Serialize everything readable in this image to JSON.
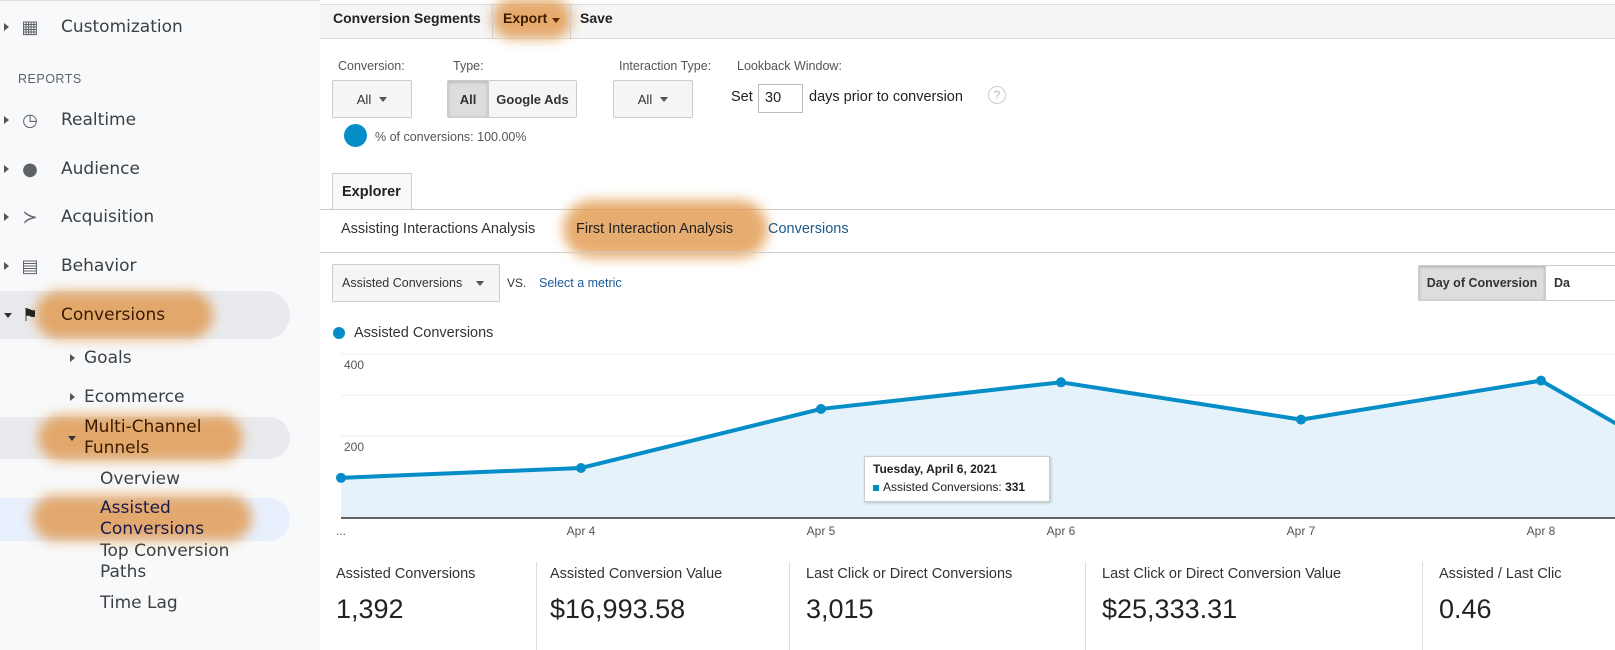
{
  "sidebar": {
    "customization": "Customization",
    "reports_heading": "REPORTS",
    "items": [
      {
        "label": "Realtime",
        "icon": "clock-icon"
      },
      {
        "label": "Audience",
        "icon": "person-icon"
      },
      {
        "label": "Acquisition",
        "icon": "acquisition-icon"
      },
      {
        "label": "Behavior",
        "icon": "behavior-icon"
      },
      {
        "label": "Conversions",
        "icon": "flag-icon"
      }
    ],
    "conversions_children": [
      "Goals",
      "Ecommerce",
      "Multi-Channel Funnels"
    ],
    "mcf_children": [
      "Overview",
      "Assisted Conversions",
      "Top Conversion Paths",
      "Time Lag"
    ]
  },
  "toolbar": {
    "segments": "Conversion Segments",
    "export": "Export",
    "save": "Save"
  },
  "filters": {
    "conversion_label": "Conversion:",
    "conversion_value": "All",
    "type_label": "Type:",
    "type_options": [
      "All",
      "Google Ads"
    ],
    "interaction_label": "Interaction Type:",
    "interaction_value": "All",
    "lookback_label": "Lookback Window:",
    "set": "Set",
    "lookback_days": "30",
    "lookback_suffix": "days prior to conversion",
    "help": "?",
    "pct_text": "% of conversions: 100.00%"
  },
  "tabs": {
    "explorer": "Explorer",
    "sub": [
      "Assisting Interactions Analysis",
      "First Interaction Analysis",
      "Conversions"
    ]
  },
  "metric": {
    "selected": "Assisted Conversions",
    "vs": "VS.",
    "select": "Select a metric",
    "day_of_conversion": "Day of Conversion",
    "day_other": "Da"
  },
  "colors": {
    "series": "#058dc7",
    "fill": "#e5f2f9",
    "highlight": "#e0913f"
  },
  "chart_data": {
    "type": "area",
    "legend": "Assisted Conversions",
    "x": [
      "...",
      "Apr 4",
      "Apr 5",
      "Apr 6",
      "Apr 7",
      "Apr 8",
      ""
    ],
    "series": [
      {
        "name": "Assisted Conversions",
        "values": [
          98,
          122,
          266,
          331,
          240,
          335,
          0
        ]
      }
    ],
    "yticks": [
      "200",
      "400"
    ],
    "ylim": [
      0,
      400
    ],
    "grid": true,
    "tooltip": {
      "title": "Tuesday, April 6, 2021",
      "label": "Assisted Conversions:",
      "value": "331"
    }
  },
  "kpis": [
    {
      "title": "Assisted Conversions",
      "value": "1,392"
    },
    {
      "title": "Assisted Conversion Value",
      "value": "$16,993.58"
    },
    {
      "title": "Last Click or Direct Conversions",
      "value": "3,015"
    },
    {
      "title": "Last Click or Direct Conversion Value",
      "value": "$25,333.31"
    },
    {
      "title": "Assisted / Last Clic",
      "value": "0.46"
    }
  ]
}
